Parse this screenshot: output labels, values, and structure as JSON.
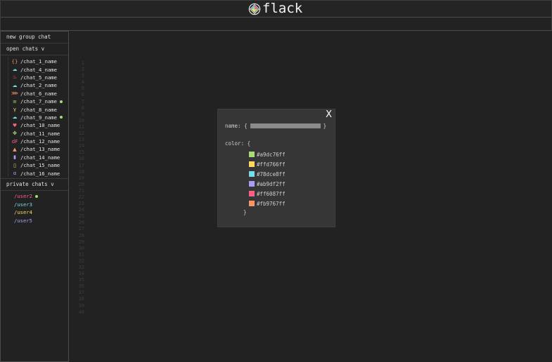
{
  "header": {
    "title": "flack"
  },
  "sidebar": {
    "new_group_label": "new group chat",
    "open_chats_label": "open chats v",
    "chats": [
      {
        "name": "/chat_1_name",
        "icon": "{}",
        "icon_color": "#fc9867",
        "online": false
      },
      {
        "name": "/chat_4_name",
        "icon": "☁",
        "icon_color": "#78dce8",
        "online": false
      },
      {
        "name": "/chat_5_name",
        "icon": "♨",
        "icon_color": "#ff6188",
        "online": false
      },
      {
        "name": "/chat_2_name",
        "icon": "☁",
        "icon_color": "#78dce8",
        "online": false
      },
      {
        "name": "/chat_6_name",
        "icon": "⋙",
        "icon_color": "#fc9867",
        "online": false
      },
      {
        "name": "/chat_7_name",
        "icon": "≡",
        "icon_color": "#a9dc76",
        "online": true
      },
      {
        "name": "/chat_8_name",
        "icon": "γ",
        "icon_color": "#ffd866",
        "online": false
      },
      {
        "name": "/chat_9_name",
        "icon": "☁",
        "icon_color": "#78dce8",
        "online": true
      },
      {
        "name": "/chat_10_name",
        "icon": "♥",
        "icon_color": "#ff6188",
        "online": false
      },
      {
        "name": "/chat_11_name",
        "icon": "✤",
        "icon_color": "#a9dc76",
        "online": false
      },
      {
        "name": "/chat_12_name",
        "icon": "dF",
        "icon_color": "#ff6188",
        "online": false
      },
      {
        "name": "/chat_13_name",
        "icon": "▲",
        "icon_color": "#fc9867",
        "online": false
      },
      {
        "name": "/chat_14_name",
        "icon": "▮",
        "icon_color": "#ab9df2",
        "online": false
      },
      {
        "name": "/chat_15_name",
        "icon": "▯",
        "icon_color": "#ffd866",
        "online": false
      },
      {
        "name": "/chat_16_name",
        "icon": "α",
        "icon_color": "#ab9df2",
        "online": false
      }
    ],
    "private_chats_label": "private chats v",
    "private": [
      {
        "name": "/user2",
        "color": "#ff6188",
        "online": true
      },
      {
        "name": "/user3",
        "color": "#78dce8",
        "online": false
      },
      {
        "name": "/user4",
        "color": "#ffd866",
        "online": false
      },
      {
        "name": "/user5",
        "color": "#ab9df2",
        "online": false
      }
    ]
  },
  "line_numbers": [
    "1",
    "2",
    "3",
    "4",
    "5",
    "6",
    "7",
    "8",
    "9",
    "10",
    "11",
    "12",
    "13",
    "14",
    "15",
    "16",
    "17",
    "18",
    "19",
    "20",
    "21",
    "22",
    "23",
    "24",
    "25",
    "26",
    "27",
    "28",
    "29",
    "30",
    "31",
    "32",
    "33",
    "34",
    "35",
    "36",
    "37",
    "38",
    "39",
    "40"
  ],
  "modal": {
    "close_label": "X",
    "name_label": "name: {",
    "name_value": "",
    "name_close": "}",
    "color_label": "color: {",
    "colors": [
      "#a9dc76ff",
      "#ffd766ff",
      "#78dce8ff",
      "#ab9df2ff",
      "#ff6087ff",
      "#fb9767ff"
    ],
    "color_close": "}"
  },
  "colors": {
    "background": "#222222",
    "online_dot": "#a9dc76",
    "modal_bg": "#363636"
  }
}
